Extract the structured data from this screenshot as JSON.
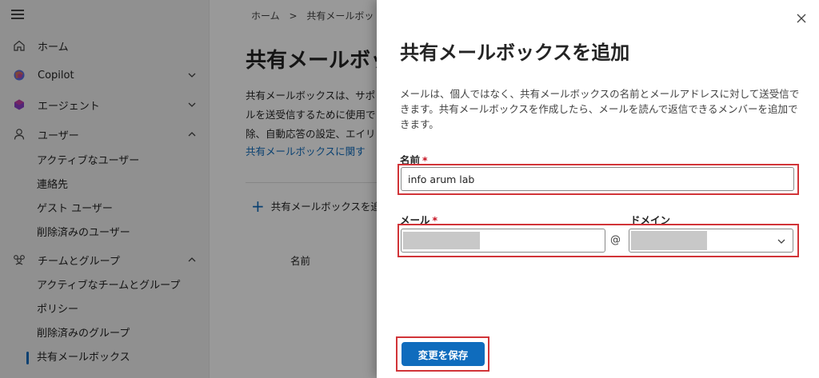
{
  "sidebar": {
    "items": [
      {
        "label": "ホーム",
        "icon": "home-icon"
      },
      {
        "label": "Copilot",
        "icon": "copilot-icon"
      },
      {
        "label": "エージェント",
        "icon": "agent-icon"
      },
      {
        "label": "ユーザー",
        "icon": "user-icon"
      },
      {
        "label": "チームとグループ",
        "icon": "teams-icon"
      }
    ],
    "user_subitems": [
      "アクティブなユーザー",
      "連絡先",
      "ゲスト ユーザー",
      "削除済みのユーザー"
    ],
    "team_subitems": [
      "アクティブなチームとグループ",
      "ポリシー",
      "削除済みのグループ",
      "共有メールボックス"
    ]
  },
  "main": {
    "breadcrumb_home": "ホーム",
    "breadcrumb_sep": ">",
    "breadcrumb_current": "共有メールボッ",
    "title": "共有メールボッ",
    "desc_lines": [
      "共有メールボックスは、サポ",
      "ルを送受信するために使用で",
      "除、自動応答の設定、エイリ"
    ],
    "link": "共有メールボックスに関す",
    "add_label": "共有メールボックスを追",
    "column_name": "名前"
  },
  "panel": {
    "title": "共有メールボックスを追加",
    "description": "メールは、個人ではなく、共有メールボックスの名前とメールアドレスに対して送受信できます。共有メールボックスを作成したら、メールを読んで返信できるメンバーを追加できます。",
    "name_label": "名前",
    "name_value": "info arum lab",
    "email_label": "メール",
    "at_sign": "@",
    "domain_label": "ドメイン",
    "required_mark": "*",
    "save_label": "変更を保存"
  },
  "colors": {
    "accent": "#0f6cbd",
    "highlight": "#d13438",
    "required": "#c50f1f"
  }
}
